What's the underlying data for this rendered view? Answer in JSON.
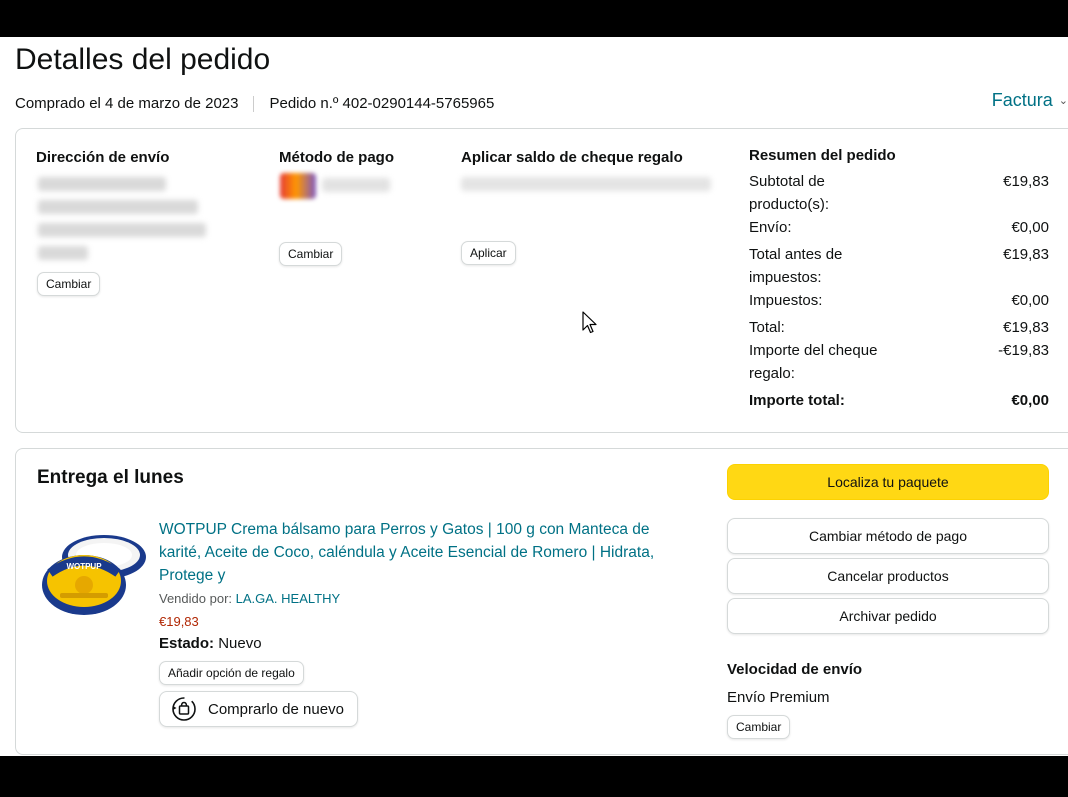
{
  "page": {
    "title": "Detalles del pedido",
    "purchased": "Comprado el 4 de marzo de 2023",
    "order": "Pedido n.º 402-0290144-5765965",
    "invoice": "Factura"
  },
  "shipping": {
    "heading": "Dirección de envío",
    "change": "Cambiar"
  },
  "payment": {
    "heading": "Método de pago",
    "change": "Cambiar"
  },
  "gift": {
    "heading": "Aplicar saldo de cheque regalo",
    "apply": "Aplicar"
  },
  "summary": {
    "heading": "Resumen del pedido",
    "rows": [
      {
        "label": "Subtotal de producto(s):",
        "value": "€19,83"
      },
      {
        "label": "Envío:",
        "value": "€0,00"
      },
      {
        "label": "Total antes de impuestos:",
        "value": "€19,83"
      },
      {
        "label": "Impuestos:",
        "value": "€0,00"
      },
      {
        "label": "Total:",
        "value": "€19,83"
      },
      {
        "label": "Importe del cheque regalo:",
        "value": "-€19,83"
      }
    ],
    "grand_label": "Importe total:",
    "grand_value": "€0,00"
  },
  "delivery": {
    "heading": "Entrega el lunes",
    "product_title": "WOTPUP Crema bálsamo para Perros y Gatos | 100 g con Manteca de karité, Aceite de Coco, caléndula y Aceite Esencial de Romero | Hidrata, Protege y",
    "sold_by_label": "Vendido por:",
    "seller": "LA.GA. HEALTHY",
    "price": "€19,83",
    "state_label": "Estado:",
    "state_value": "Nuevo",
    "gift_option": "Añadir opción de regalo",
    "buy_again": "Comprarlo de nuevo",
    "product_logo_text": "WOTPUP"
  },
  "actions": {
    "track": "Localiza tu paquete",
    "change_payment": "Cambiar método de pago",
    "cancel": "Cancelar productos",
    "archive": "Archivar pedido",
    "speed_heading": "Velocidad de envío",
    "speed_value": "Envío Premium",
    "speed_change": "Cambiar"
  },
  "colors": {
    "link": "#007185",
    "price": "#b12704",
    "primary_button": "#ffd814"
  }
}
